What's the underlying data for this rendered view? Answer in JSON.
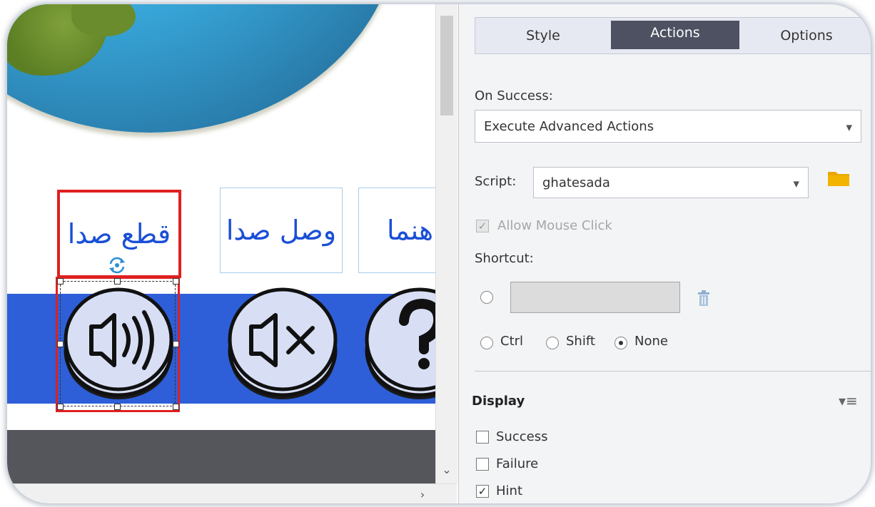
{
  "stage": {
    "labels": {
      "mute": "قطع صدا",
      "unmute": "وصل صدا",
      "help": "هنما"
    }
  },
  "panel": {
    "tabs": [
      {
        "label": "Style",
        "active": false
      },
      {
        "label": "Actions",
        "active": true
      },
      {
        "label": "Options",
        "active": false
      }
    ],
    "on_success_label": "On Success:",
    "on_success_value": "Execute Advanced Actions",
    "script_label": "Script:",
    "script_value": "ghatesada",
    "allow_mouse_click": {
      "label": "Allow Mouse Click",
      "checked": true,
      "disabled": true
    },
    "shortcut_label": "Shortcut:",
    "shortcut_value": "",
    "modifiers": [
      {
        "label": "Ctrl",
        "selected": false
      },
      {
        "label": "Shift",
        "selected": false
      },
      {
        "label": "None",
        "selected": true
      }
    ],
    "display_heading": "Display",
    "display_options": [
      {
        "label": "Success",
        "checked": false
      },
      {
        "label": "Failure",
        "checked": false
      },
      {
        "label": "Hint",
        "checked": true
      }
    ]
  },
  "colors": {
    "stage_blue": "#2e5fd8",
    "arabic_text": "#1a4fd6",
    "selection_red": "#e02020",
    "active_tab": "#4d5162",
    "folder": "#e8a800"
  },
  "icons": [
    "speaker-icon",
    "mute-speaker-icon",
    "question-icon",
    "rotate-handle-icon",
    "folder-icon",
    "trash-icon",
    "chevron-down-icon",
    "chevron-right-icon",
    "panel-menu-icon",
    "dropdown-arrow-icon"
  ]
}
